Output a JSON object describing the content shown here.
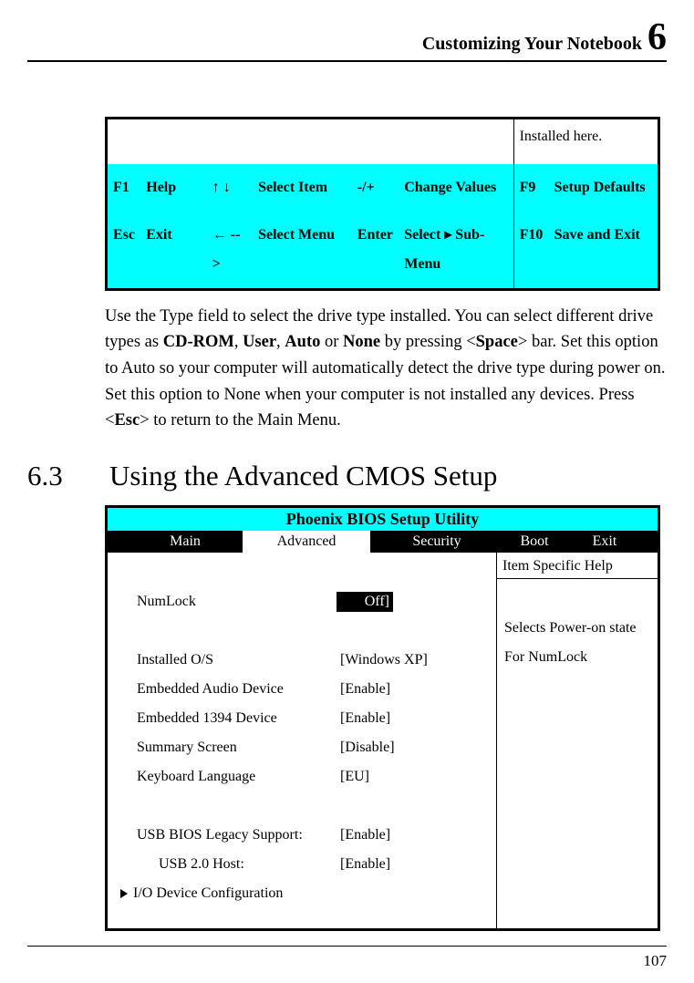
{
  "header": {
    "title": "Customizing Your Notebook",
    "chapter": "6"
  },
  "top_table": {
    "r1c2": "Installed here.",
    "nav1": {
      "k1": "F1",
      "l1": "Help",
      "k2": "↑ ↓",
      "l2": "Select Item",
      "k3": "-/+",
      "l3": "Change Values",
      "k4": "F9",
      "l4": "Setup Defaults"
    },
    "nav2": {
      "k1": "Esc",
      "l1": "Exit",
      "k2": "← -->",
      "l2": "Select Menu",
      "k3": "Enter",
      "l3": "Select ▸ Sub-Menu",
      "k4": "F10",
      "l4": "Save and Exit"
    }
  },
  "para": {
    "p1": "Use the Type field to select the drive type installed. You can select different drive types as ",
    "b1": "CD-ROM",
    "s1": ", ",
    "b2": "User",
    "s2": ", ",
    "b3": "Auto",
    "s3": " or ",
    "b4": "None",
    "s4": " by pressing <",
    "b5": "Space",
    "s5": "> bar. Set this option to Auto so your computer will automatically detect the drive type during power on. Set this option to None when your computer is not installed any devices. Press <",
    "b6": "Esc",
    "s6": "> to return to the Main Menu."
  },
  "section": {
    "num": "6.3",
    "title": "Using the Advanced CMOS Setup"
  },
  "bios": {
    "title": "Phoenix BIOS Setup Utility",
    "tabs": {
      "main": "Main",
      "advanced": "Advanced",
      "security": "Security",
      "boot": "Boot",
      "exit": "Exit"
    },
    "help_header": "Item Specific Help",
    "help_text_l1": "Selects Power-on state",
    "help_text_l2": "For NumLock",
    "items": {
      "numlock_l": "NumLock",
      "numlock_v": "Off]",
      "os_l": "Installed O/S",
      "os_v": "[Windows XP]",
      "audio_l": "Embedded Audio Device",
      "audio_v": "[Enable]",
      "ieee_l": "Embedded 1394 Device",
      "ieee_v": "[Enable]",
      "sum_l": "Summary Screen",
      "sum_v": "[Disable]",
      "kbd_l": "Keyboard Language",
      "kbd_v": "[EU]",
      "usb_l": "USB BIOS Legacy Support:",
      "usb_v": "[Enable]",
      "usb2_l": "USB 2.0 Host:",
      "usb2_v": "[Enable]",
      "io_l": "I/O Device Configuration"
    }
  },
  "page_number": "107"
}
